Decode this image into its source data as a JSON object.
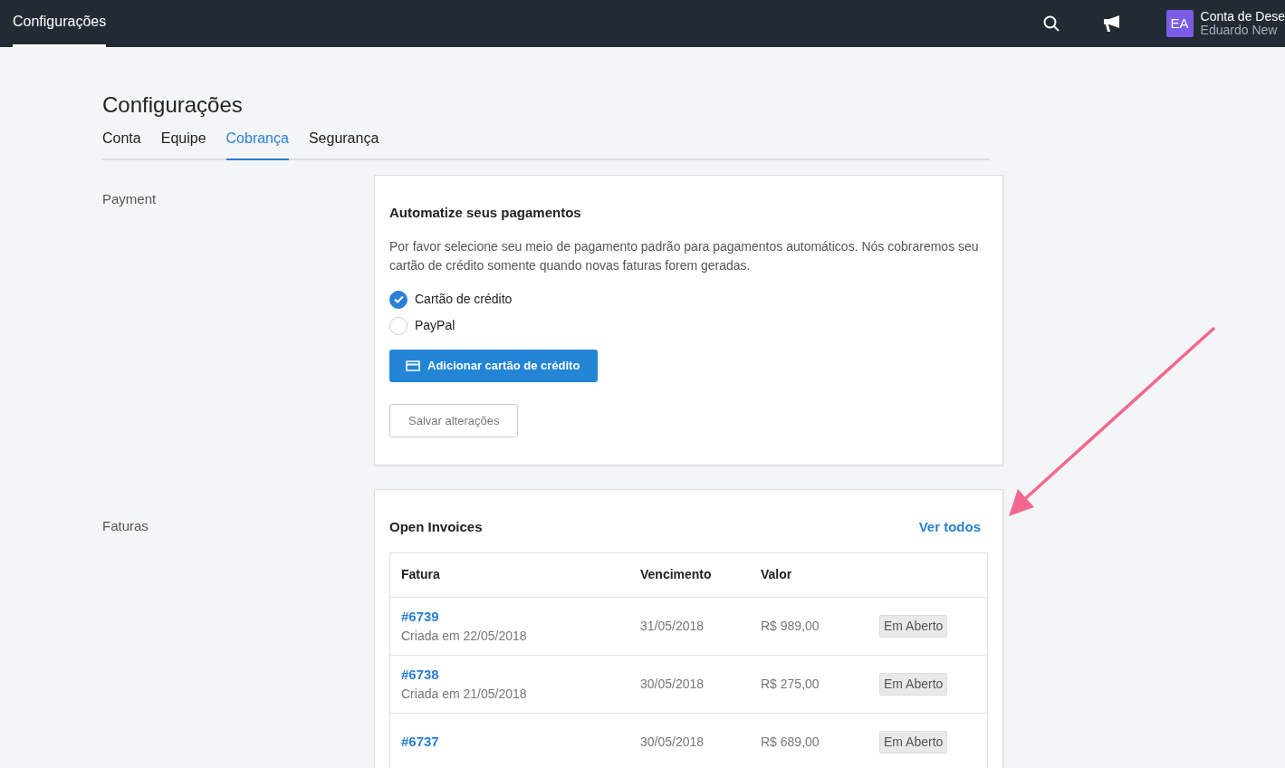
{
  "topbar": {
    "title": "Configurações",
    "account": {
      "initials": "EA",
      "name": "Conta de Dese",
      "user": "Eduardo New"
    }
  },
  "page_title": "Configurações",
  "tabs": [
    {
      "label": "Conta",
      "selected": false
    },
    {
      "label": "Equipe",
      "selected": false
    },
    {
      "label": "Cobrança",
      "selected": true
    },
    {
      "label": "Segurança",
      "selected": false
    }
  ],
  "payment": {
    "section_label": "Payment",
    "title": "Automatize seus pagamentos",
    "description": "Por favor selecione seu meio de pagamento padrão para pagamentos automáticos. Nós cobraremos seu cartão de crédito somente quando novas faturas forem geradas.",
    "options": [
      {
        "label": "Cartão de crédito",
        "selected": true
      },
      {
        "label": "PayPal",
        "selected": false
      }
    ],
    "add_button": "Adicionar cartão de crédito",
    "save_button": "Salvar alterações"
  },
  "invoices": {
    "section_label": "Faturas",
    "title": "Open Invoices",
    "link": "Ver todos",
    "columns": [
      "Fatura",
      "Vencimento",
      "Valor"
    ],
    "rows": [
      {
        "number": "#6739",
        "created": "Criada em 22/05/2018",
        "due": "31/05/2018",
        "amount": "R$ 989,00",
        "status": "Em Aberto"
      },
      {
        "number": "#6738",
        "created": "Criada em 21/05/2018",
        "due": "30/05/2018",
        "amount": "R$ 275,00",
        "status": "Em Aberto"
      },
      {
        "number": "#6737",
        "due": "30/05/2018",
        "amount": "R$ 689,00",
        "status": "Em Aberto"
      }
    ]
  }
}
